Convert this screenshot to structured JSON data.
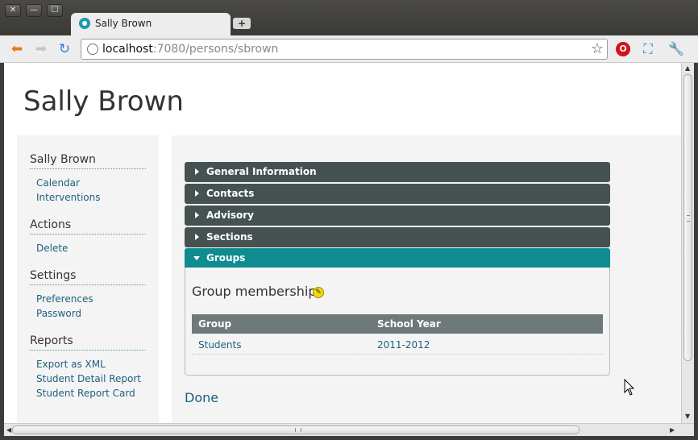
{
  "window": {
    "close": "✕",
    "minimize": "—",
    "maximize": "☐"
  },
  "browser": {
    "tab_title": "Sally Brown",
    "new_tab": "+",
    "url_host": "localhost",
    "url_rest": ":7080/persons/sbrown"
  },
  "page": {
    "title": "Sally Brown"
  },
  "sidebar": {
    "sections": [
      {
        "heading": "Sally Brown",
        "links": [
          "Calendar",
          "Interventions"
        ]
      },
      {
        "heading": "Actions",
        "links": [
          "Delete"
        ]
      },
      {
        "heading": "Settings",
        "links": [
          "Preferences",
          "Password"
        ]
      },
      {
        "heading": "Reports",
        "links": [
          "Export as XML",
          "Student Detail Report",
          "Student Report Card"
        ]
      }
    ]
  },
  "accordion": {
    "sections": [
      "General Information",
      "Contacts",
      "Advisory",
      "Sections",
      "Groups"
    ],
    "open_section": "Groups"
  },
  "groups": {
    "title": "Group memberships",
    "columns": [
      "Group",
      "School Year"
    ],
    "rows": [
      [
        "Students",
        "2011-2012"
      ]
    ]
  },
  "done_label": "Done",
  "colors": {
    "accordion_header": "#465252",
    "accordion_open": "#0f8c8f",
    "link": "#1d5f7e"
  }
}
